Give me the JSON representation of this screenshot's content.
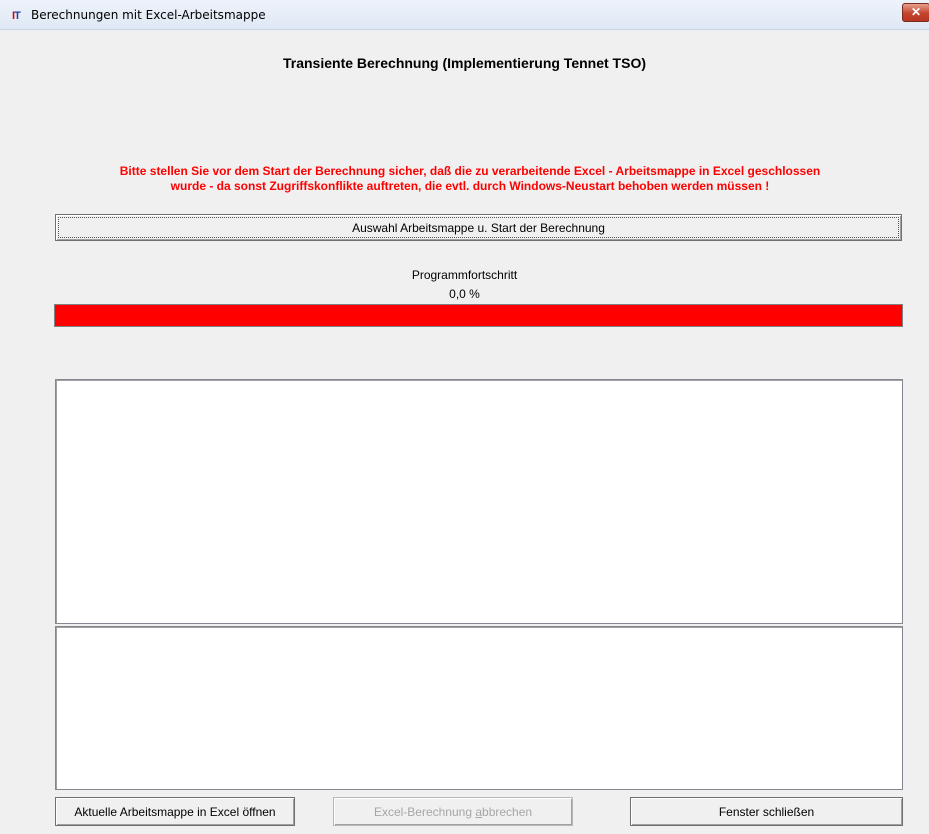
{
  "window": {
    "title": "Berechnungen mit Excel-Arbeitsmappe",
    "close_symbol": "✕"
  },
  "heading": "Transiente Berechnung (Implementierung Tennet TSO)",
  "warning": {
    "line1": "Bitte stellen Sie vor dem Start der Berechnung sicher, daß die zu verarbeitende Excel - Arbeitsmappe in Excel geschlossen",
    "line2": "wurde - da sonst Zugriffskonflikte auftreten, die evtl. durch Windows-Neustart behoben werden müssen !",
    "color": "#ff0000"
  },
  "start_button": {
    "label": "Auswahl Arbeitsmappe u. Start der Berechnung"
  },
  "progress": {
    "label": "Programmfortschritt",
    "value_text": "0,0 %",
    "fraction": 0.0,
    "bar_color": "#ff0000"
  },
  "log_primary": {
    "text": ""
  },
  "log_secondary": {
    "text": ""
  },
  "footer": {
    "open_label": "Aktuelle Arbeitsmappe in Excel öffnen",
    "cancel_label_pre": "Excel-Berechnung ",
    "cancel_label_mnemonic": "a",
    "cancel_label_post": "bbrechen",
    "close_label": "Fenster schließen"
  }
}
